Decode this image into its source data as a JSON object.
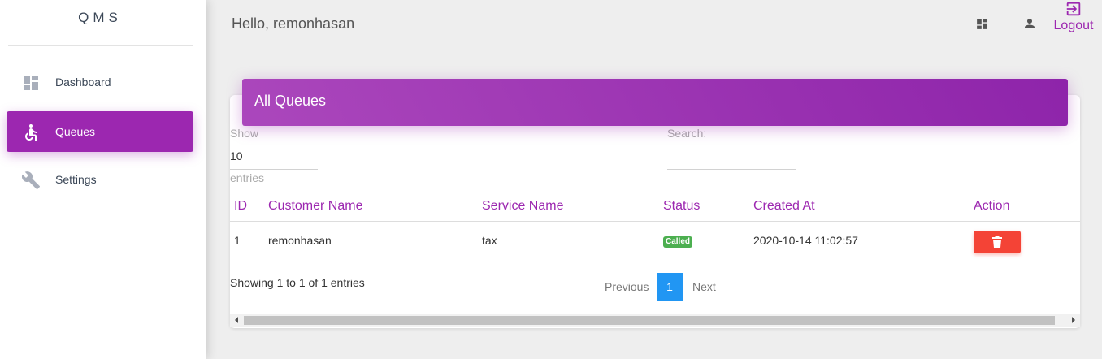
{
  "app": {
    "brand": "QMS"
  },
  "sidebar": {
    "items": [
      {
        "label": "Dashboard",
        "icon": "dashboard-icon",
        "active": false
      },
      {
        "label": "Queues",
        "icon": "accessible-icon",
        "active": true
      },
      {
        "label": "Settings",
        "icon": "wrench-icon",
        "active": false
      }
    ]
  },
  "topbar": {
    "greeting": "Hello, remonhasan",
    "logout_label": "Logout",
    "icons": [
      "dashboard-icon",
      "person-icon",
      "exit-icon"
    ]
  },
  "card": {
    "title": "All Queues",
    "length": {
      "show_label": "Show",
      "value": "10",
      "entries_label": "entries"
    },
    "search": {
      "label": "Search:",
      "value": ""
    },
    "columns": [
      "ID",
      "Customer Name",
      "Service Name",
      "Status",
      "Created At",
      "Action"
    ],
    "rows": [
      {
        "id": "1",
        "customer": "remonhasan",
        "service": "tax",
        "status": "Called",
        "created_at": "2020-10-14 11:02:57",
        "action_icon": "trash-icon"
      }
    ],
    "info": "Showing 1 to 1 of 1 entries",
    "pagination": {
      "previous": "Previous",
      "current": "1",
      "next": "Next"
    }
  },
  "colors": {
    "accent": "#9c27b0",
    "status_called": "#4caf50",
    "delete": "#f44336",
    "page_active": "#2196f3"
  }
}
